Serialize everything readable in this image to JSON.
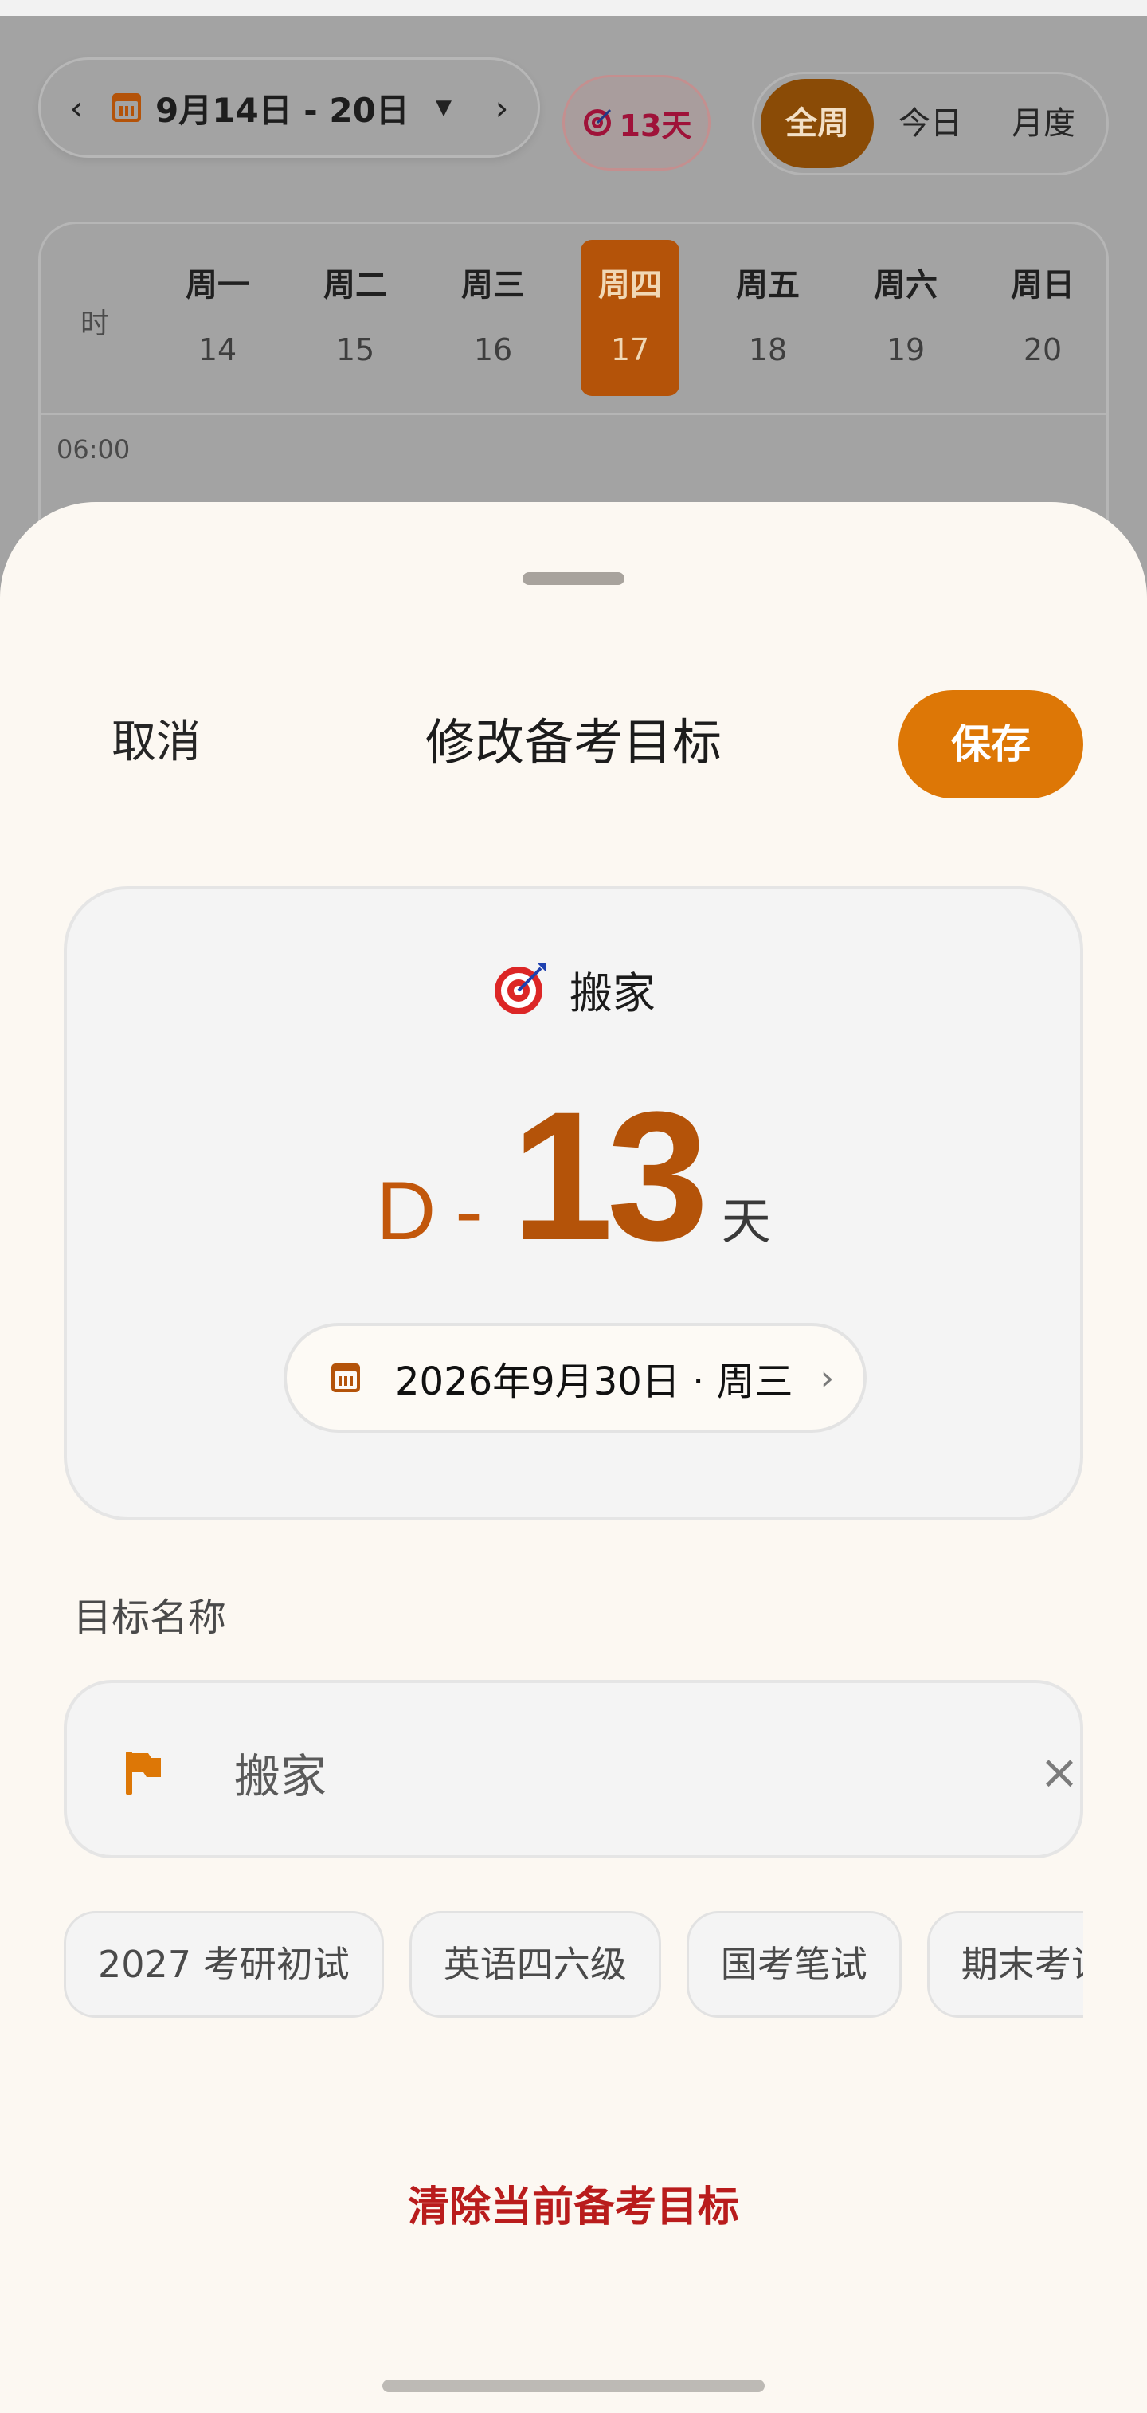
{
  "header": {
    "week_range": "9月14日 - 20日",
    "countdown_badge": "13天",
    "view_modes": [
      "全周",
      "今日",
      "月度"
    ],
    "active_view": "全周"
  },
  "calendar": {
    "time_col_label": "时",
    "days": [
      {
        "weekday": "周一",
        "date": "14"
      },
      {
        "weekday": "周二",
        "date": "15"
      },
      {
        "weekday": "周三",
        "date": "16"
      },
      {
        "weekday": "周四",
        "date": "17",
        "today": true
      },
      {
        "weekday": "周五",
        "date": "18"
      },
      {
        "weekday": "周六",
        "date": "19"
      },
      {
        "weekday": "周日",
        "date": "20"
      }
    ],
    "first_time_slot": "06:00"
  },
  "sheet": {
    "cancel_label": "取消",
    "title": "修改备考目标",
    "save_label": "保存",
    "goal": {
      "name": "搬家",
      "dday_prefix": "D",
      "dday_dash": "-",
      "days_left": "13",
      "days_unit": "天",
      "target_date": "2026年9月30日 · 周三"
    },
    "name_field": {
      "label": "目标名称",
      "value": "搬家"
    },
    "presets": [
      "2027 考研初试",
      "英语四六级",
      "国考笔试",
      "期末考试"
    ],
    "clear_goal_label": "清除当前备考目标"
  },
  "colors": {
    "accent": "#dd7706",
    "accent_dark": "#b45309",
    "danger": "#b91c1c",
    "sheet_bg": "#fcf8f2"
  }
}
